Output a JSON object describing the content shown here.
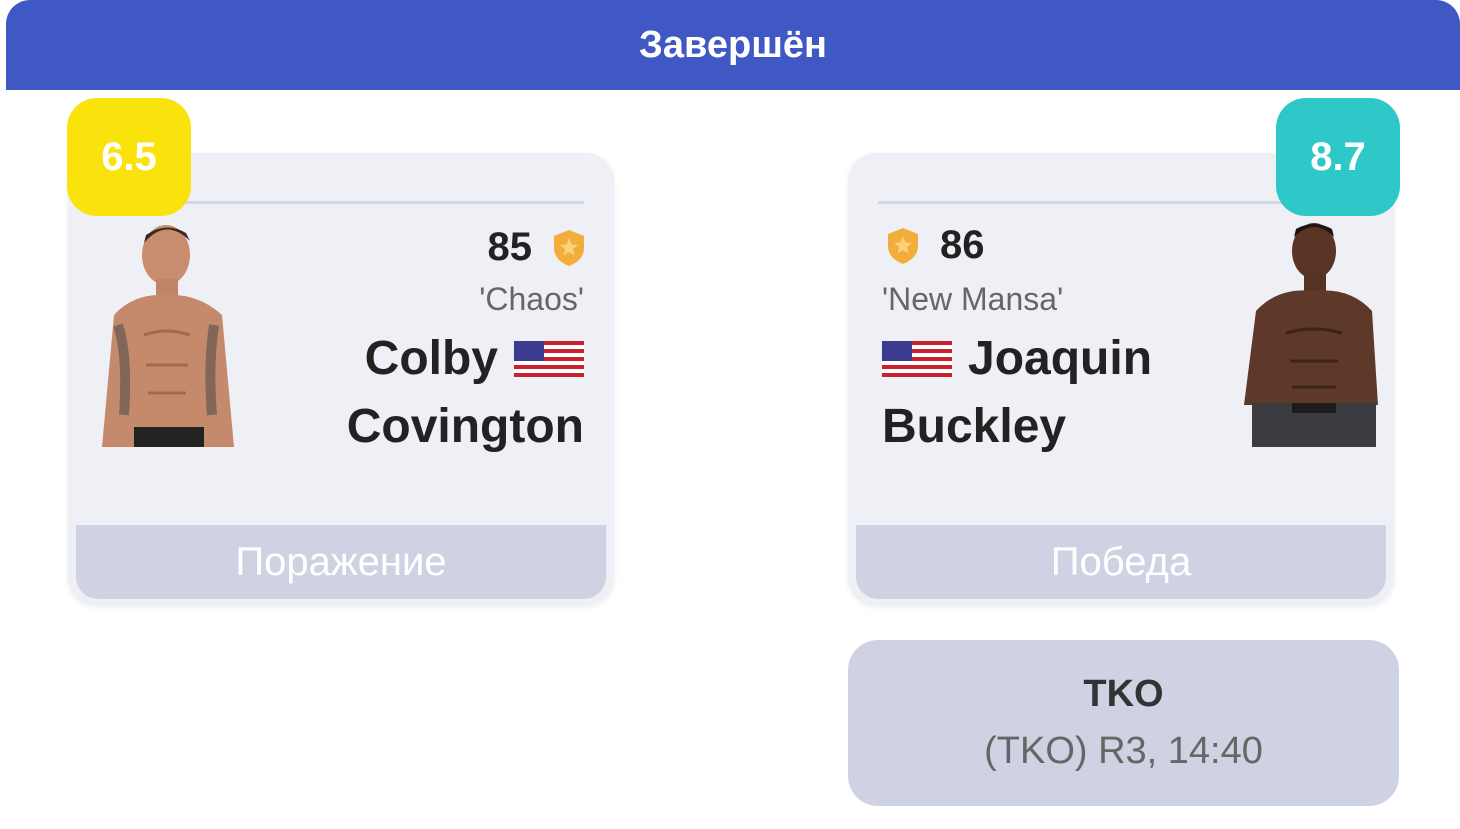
{
  "header": {
    "status": "Завершён"
  },
  "fighters": [
    {
      "side": "left",
      "rating": "6.5",
      "rating_color": "#fae20c",
      "score": "85",
      "nickname": "'Chaos'",
      "first_name": "Colby",
      "last_name": "Covington",
      "flag_icon": "us-flag-icon",
      "result": "Поражение"
    },
    {
      "side": "right",
      "rating": "8.7",
      "rating_color": "#2fc8c8",
      "score": "86",
      "nickname": "'New Mansa'",
      "first_name": "Joaquin",
      "last_name": "Buckley",
      "flag_icon": "us-flag-icon",
      "result": "Победа"
    }
  ],
  "method": {
    "title": "TKO",
    "detail": "(TKO) R3, 14:40"
  },
  "colors": {
    "header_bg": "#3f58c4",
    "card_bg": "#eff0f5",
    "result_bar": "#cfd2e2",
    "badge": "#f2ad3a"
  }
}
